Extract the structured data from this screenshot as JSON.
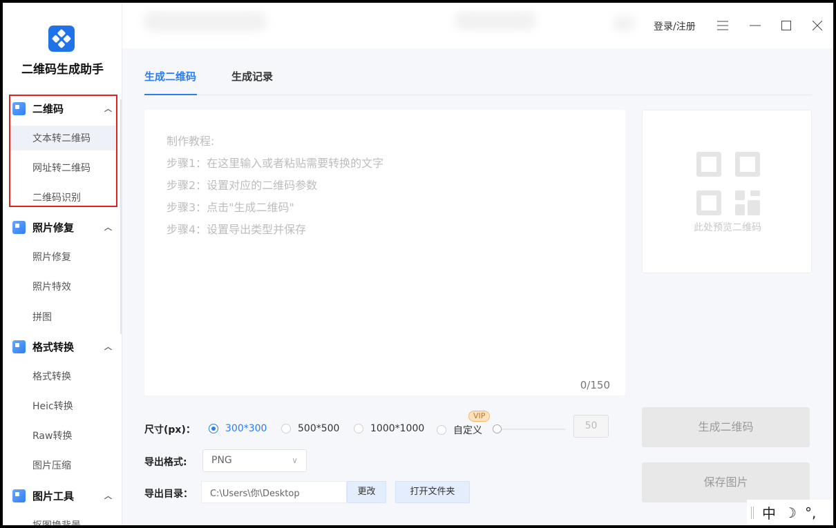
{
  "app": {
    "title": "二维码生成助手"
  },
  "titlebar": {
    "login": "登录/注册"
  },
  "sidebar": {
    "sections": [
      {
        "label": "二维码",
        "items": [
          "文本转二维码",
          "网址转二维码",
          "二维码识别"
        ]
      },
      {
        "label": "照片修复",
        "items": [
          "照片修复",
          "照片特效",
          "拼图"
        ]
      },
      {
        "label": "格式转换",
        "items": [
          "格式转换",
          "Heic转换",
          "Raw转换",
          "图片压缩"
        ]
      },
      {
        "label": "图片工具",
        "items": [
          "抠图换背景"
        ]
      }
    ],
    "active_item": "文本转二维码"
  },
  "tabs": [
    {
      "label": "生成二维码",
      "active": true
    },
    {
      "label": "生成记录",
      "active": false
    }
  ],
  "editor": {
    "lines": [
      "制作教程:",
      "步骤1：在这里输入或者粘贴需要转换的文字",
      "步骤2：设置对应的二维码参数",
      "步骤3：点击\"生成二维码\"",
      "步骤4：设置导出类型并保存"
    ],
    "counter": "0/150"
  },
  "preview": {
    "label": "此处预览二维码"
  },
  "options": {
    "size_label": "尺寸(px)：",
    "sizes": [
      "300*300",
      "500*500",
      "1000*1000",
      "自定义"
    ],
    "selected_size": "300*300",
    "vip": "VIP",
    "custom_value": "50",
    "format_label": "导出格式:",
    "format_value": "PNG",
    "dir_label": "导出目录：",
    "dir_value": "C:\\Users\\你\\Desktop",
    "change_btn": "更改",
    "open_folder_btn": "打开文件夹"
  },
  "actions": {
    "generate": "生成二维码",
    "save": "保存图片"
  },
  "ime": {
    "lang": "中",
    "moon": "☽",
    "punct": "°,"
  },
  "colors": {
    "accent": "#2b7cf0",
    "highlight_border": "#e02020",
    "logo_bg": "#1f72e8"
  }
}
